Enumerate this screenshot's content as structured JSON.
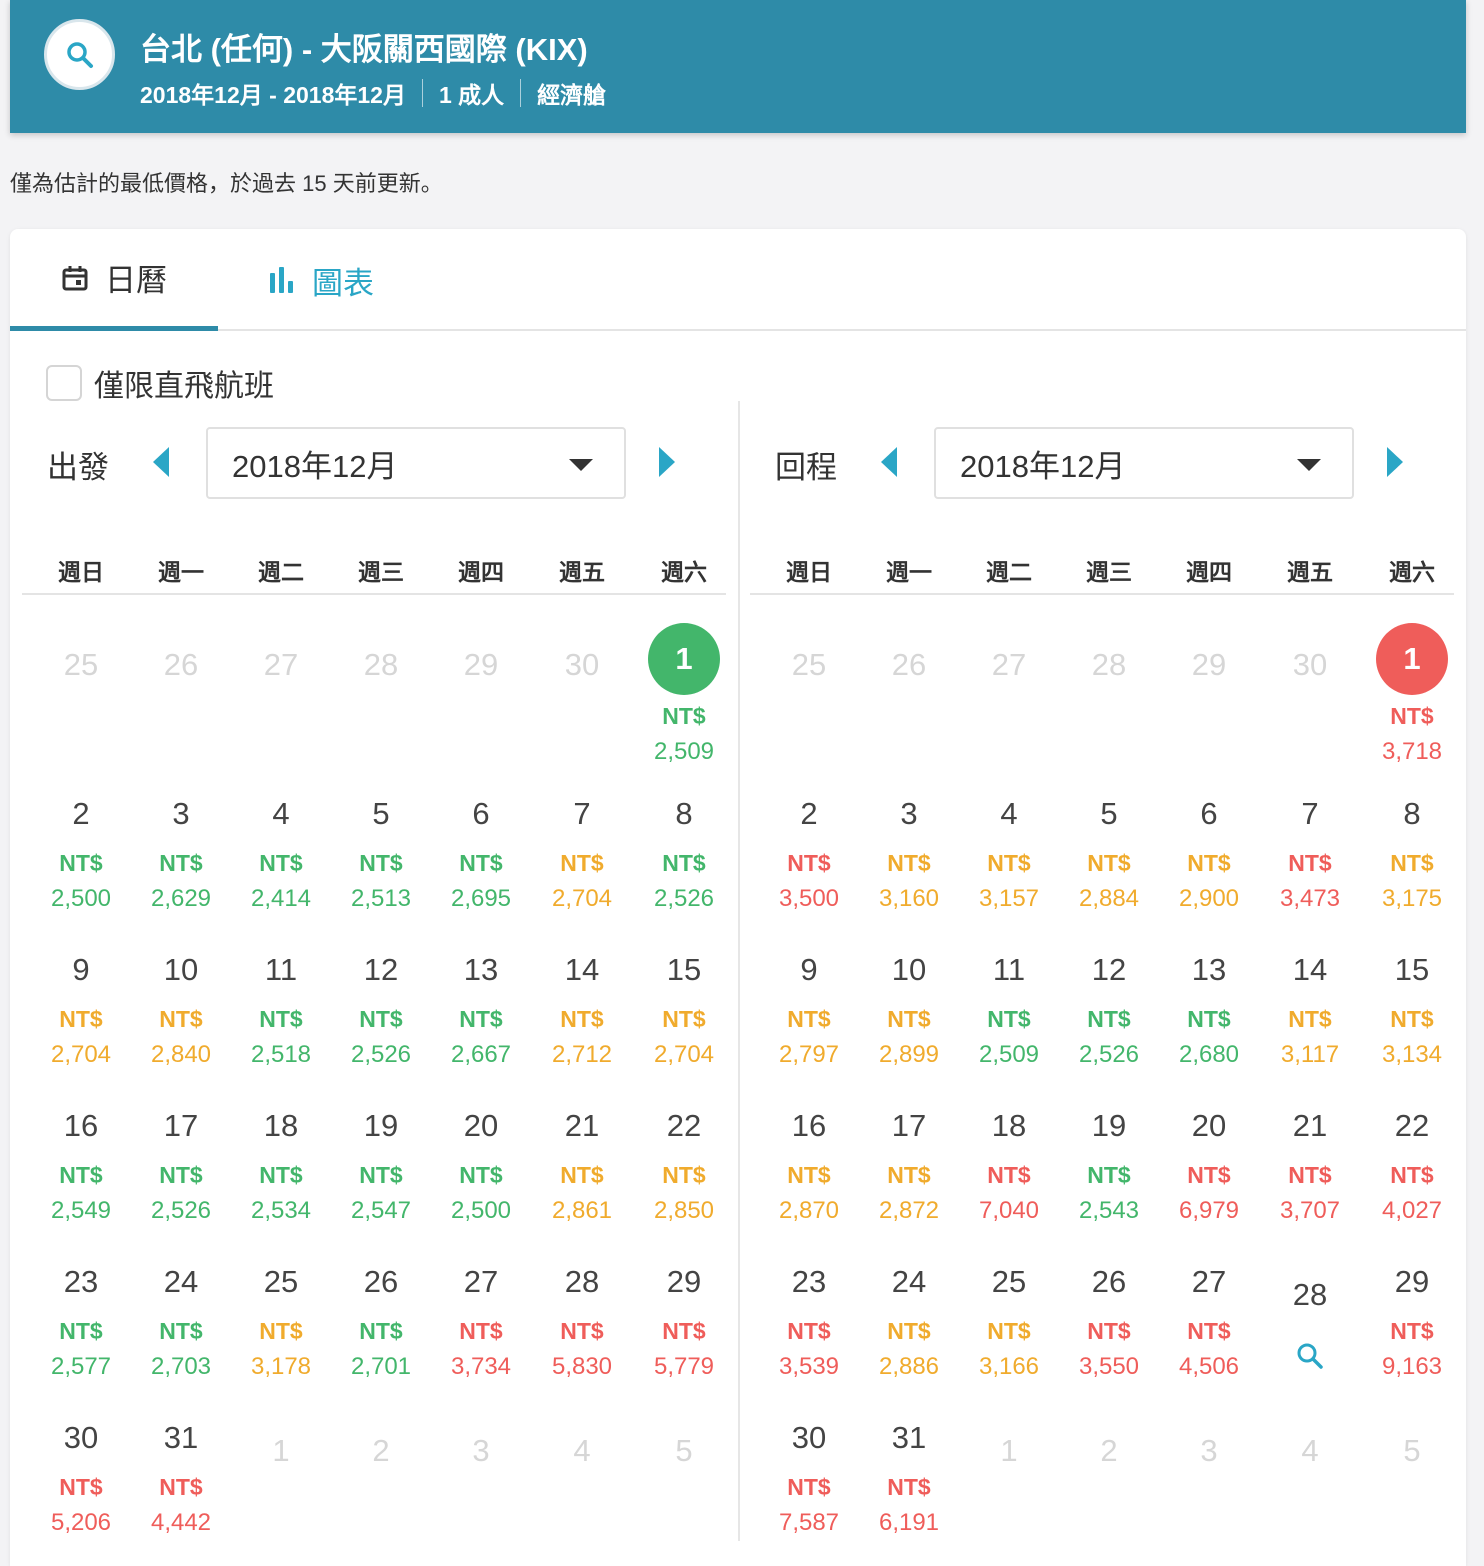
{
  "header": {
    "title": "台北 (任何) - 大阪關西國際 (KIX)",
    "dates": "2018年12月 - 2018年12月",
    "passengers": "1 成人",
    "cabin": "經濟艙",
    "search_icon": "search-icon"
  },
  "notice": "僅為估計的最低價格，於過去 15 天前更新。",
  "tabs": {
    "calendar": "日曆",
    "chart": "圖表",
    "calendar_icon": "calendar-icon",
    "chart_icon": "bar-chart-icon"
  },
  "filter": {
    "direct_only": "僅限直飛航班",
    "checked": false
  },
  "colors": {
    "header": "#2e8ba8",
    "cheap": "#43b66b",
    "medium": "#f0ab2d",
    "expensive": "#ef5d5a",
    "link": "#2aa6c6"
  },
  "weekdays": [
    "週日",
    "週一",
    "週二",
    "週三",
    "週四",
    "週五",
    "週六"
  ],
  "currency": "NT$",
  "departure": {
    "label": "出發",
    "month": "2018年12月",
    "days": [
      {
        "d": "25",
        "out": true
      },
      {
        "d": "26",
        "out": true
      },
      {
        "d": "27",
        "out": true
      },
      {
        "d": "28",
        "out": true
      },
      {
        "d": "29",
        "out": true
      },
      {
        "d": "30",
        "out": true
      },
      {
        "d": "1",
        "p": "2,509",
        "l": "g",
        "sel": true
      },
      {
        "d": "2",
        "p": "2,500",
        "l": "g"
      },
      {
        "d": "3",
        "p": "2,629",
        "l": "g"
      },
      {
        "d": "4",
        "p": "2,414",
        "l": "g"
      },
      {
        "d": "5",
        "p": "2,513",
        "l": "g"
      },
      {
        "d": "6",
        "p": "2,695",
        "l": "g"
      },
      {
        "d": "7",
        "p": "2,704",
        "l": "o"
      },
      {
        "d": "8",
        "p": "2,526",
        "l": "g"
      },
      {
        "d": "9",
        "p": "2,704",
        "l": "o"
      },
      {
        "d": "10",
        "p": "2,840",
        "l": "o"
      },
      {
        "d": "11",
        "p": "2,518",
        "l": "g"
      },
      {
        "d": "12",
        "p": "2,526",
        "l": "g"
      },
      {
        "d": "13",
        "p": "2,667",
        "l": "g"
      },
      {
        "d": "14",
        "p": "2,712",
        "l": "o"
      },
      {
        "d": "15",
        "p": "2,704",
        "l": "o"
      },
      {
        "d": "16",
        "p": "2,549",
        "l": "g"
      },
      {
        "d": "17",
        "p": "2,526",
        "l": "g"
      },
      {
        "d": "18",
        "p": "2,534",
        "l": "g"
      },
      {
        "d": "19",
        "p": "2,547",
        "l": "g"
      },
      {
        "d": "20",
        "p": "2,500",
        "l": "g"
      },
      {
        "d": "21",
        "p": "2,861",
        "l": "o"
      },
      {
        "d": "22",
        "p": "2,850",
        "l": "o"
      },
      {
        "d": "23",
        "p": "2,577",
        "l": "g"
      },
      {
        "d": "24",
        "p": "2,703",
        "l": "g"
      },
      {
        "d": "25",
        "p": "3,178",
        "l": "o"
      },
      {
        "d": "26",
        "p": "2,701",
        "l": "g"
      },
      {
        "d": "27",
        "p": "3,734",
        "l": "r"
      },
      {
        "d": "28",
        "p": "5,830",
        "l": "r"
      },
      {
        "d": "29",
        "p": "5,779",
        "l": "r"
      },
      {
        "d": "30",
        "p": "5,206",
        "l": "r"
      },
      {
        "d": "31",
        "p": "4,442",
        "l": "r"
      },
      {
        "d": "1",
        "out": true
      },
      {
        "d": "2",
        "out": true
      },
      {
        "d": "3",
        "out": true
      },
      {
        "d": "4",
        "out": true
      },
      {
        "d": "5",
        "out": true
      }
    ]
  },
  "return": {
    "label": "回程",
    "month": "2018年12月",
    "days": [
      {
        "d": "25",
        "out": true
      },
      {
        "d": "26",
        "out": true
      },
      {
        "d": "27",
        "out": true
      },
      {
        "d": "28",
        "out": true
      },
      {
        "d": "29",
        "out": true
      },
      {
        "d": "30",
        "out": true
      },
      {
        "d": "1",
        "p": "3,718",
        "l": "r",
        "sel": true
      },
      {
        "d": "2",
        "p": "3,500",
        "l": "r"
      },
      {
        "d": "3",
        "p": "3,160",
        "l": "o"
      },
      {
        "d": "4",
        "p": "3,157",
        "l": "o"
      },
      {
        "d": "5",
        "p": "2,884",
        "l": "o"
      },
      {
        "d": "6",
        "p": "2,900",
        "l": "o"
      },
      {
        "d": "7",
        "p": "3,473",
        "l": "r"
      },
      {
        "d": "8",
        "p": "3,175",
        "l": "o"
      },
      {
        "d": "9",
        "p": "2,797",
        "l": "o"
      },
      {
        "d": "10",
        "p": "2,899",
        "l": "o"
      },
      {
        "d": "11",
        "p": "2,509",
        "l": "g"
      },
      {
        "d": "12",
        "p": "2,526",
        "l": "g"
      },
      {
        "d": "13",
        "p": "2,680",
        "l": "g"
      },
      {
        "d": "14",
        "p": "3,117",
        "l": "o"
      },
      {
        "d": "15",
        "p": "3,134",
        "l": "o"
      },
      {
        "d": "16",
        "p": "2,870",
        "l": "o"
      },
      {
        "d": "17",
        "p": "2,872",
        "l": "o"
      },
      {
        "d": "18",
        "p": "7,040",
        "l": "r"
      },
      {
        "d": "19",
        "p": "2,543",
        "l": "g"
      },
      {
        "d": "20",
        "p": "6,979",
        "l": "r"
      },
      {
        "d": "21",
        "p": "3,707",
        "l": "r"
      },
      {
        "d": "22",
        "p": "4,027",
        "l": "r"
      },
      {
        "d": "23",
        "p": "3,539",
        "l": "r"
      },
      {
        "d": "24",
        "p": "2,886",
        "l": "o"
      },
      {
        "d": "25",
        "p": "3,166",
        "l": "o"
      },
      {
        "d": "26",
        "p": "3,550",
        "l": "r"
      },
      {
        "d": "27",
        "p": "4,506",
        "l": "r"
      },
      {
        "d": "28",
        "search": true
      },
      {
        "d": "29",
        "p": "9,163",
        "l": "r"
      },
      {
        "d": "30",
        "p": "7,587",
        "l": "r"
      },
      {
        "d": "31",
        "p": "6,191",
        "l": "r"
      },
      {
        "d": "1",
        "out": true
      },
      {
        "d": "2",
        "out": true
      },
      {
        "d": "3",
        "out": true
      },
      {
        "d": "4",
        "out": true
      },
      {
        "d": "5",
        "out": true
      }
    ]
  }
}
